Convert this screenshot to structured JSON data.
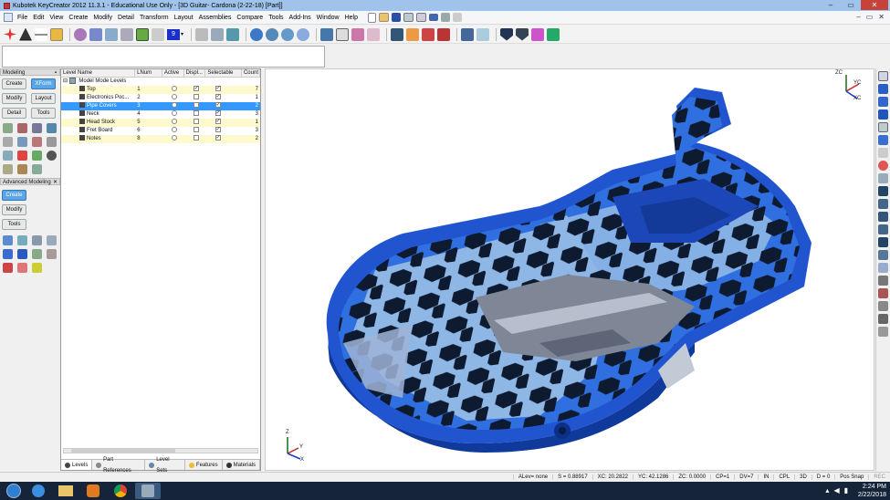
{
  "window": {
    "title": "Kubotek KeyCreator 2012 11.3.1 - Educational Use Only - [3D Guitar- Cardona (2-22-18) [Part]]",
    "controls": {
      "minimize": "–",
      "maximize": "▭",
      "close": "✕"
    }
  },
  "menu": {
    "items": [
      "File",
      "Edit",
      "View",
      "Create",
      "Modify",
      "Detail",
      "Transform",
      "Layout",
      "Assemblies",
      "Compare",
      "Tools",
      "Add-Ins",
      "Window",
      "Help"
    ],
    "right_controls": [
      "–",
      "▭",
      "✕"
    ]
  },
  "toolbar": {
    "level_value": "9",
    "icons": [
      "point-icon",
      "triangle-icon",
      "line-icon",
      "cube-icon",
      "sphere-icon",
      "shell-icon",
      "surface-icon",
      "solid-icon",
      "layers-icon",
      "color-icon",
      "grid-icon",
      "rotate-icon",
      "pan-icon",
      "zoom-icon",
      "view-icon",
      "render-icon",
      "shade-icon",
      "wireframe-icon",
      "print-icon",
      "measure-icon",
      "section-icon",
      "shield-icon",
      "snap-icon",
      "tool-icon"
    ]
  },
  "left_panel": {
    "modeling": {
      "header": "Modeling",
      "buttons": [
        "Create",
        "XForm",
        "Modify",
        "Layout",
        "Detail",
        "Tools"
      ],
      "active": "XForm"
    },
    "advanced": {
      "header": "Advanced Modeling",
      "buttons": [
        "Create",
        "Modify",
        "Tools"
      ],
      "active": "Create"
    }
  },
  "levels": {
    "columns": [
      "Level Name",
      "LNum",
      "Active",
      "Displ...",
      "Selectable",
      "Count"
    ],
    "root": "Model Mode Levels",
    "rows": [
      {
        "name": "Top",
        "lnum": "1",
        "count": "7",
        "highlight": true,
        "selected": false,
        "display": true,
        "selectable": true
      },
      {
        "name": "Electronics Poc...",
        "lnum": "2",
        "count": "1",
        "highlight": false,
        "selected": false,
        "display": false,
        "selectable": true
      },
      {
        "name": "Pipe Covers",
        "lnum": "3",
        "count": "2",
        "highlight": false,
        "selected": true,
        "display": false,
        "selectable": true
      },
      {
        "name": "Neck",
        "lnum": "4",
        "count": "3",
        "highlight": false,
        "selected": false,
        "display": false,
        "selectable": true
      },
      {
        "name": "Head Stock",
        "lnum": "5",
        "count": "1",
        "highlight": true,
        "selected": false,
        "display": false,
        "selectable": true
      },
      {
        "name": "Fret Board",
        "lnum": "6",
        "count": "3",
        "highlight": false,
        "selected": false,
        "display": false,
        "selectable": true
      },
      {
        "name": "Notes",
        "lnum": "8",
        "count": "2",
        "highlight": true,
        "selected": false,
        "display": false,
        "selectable": true
      }
    ],
    "tabs": [
      "Levels",
      "Part References",
      "Level Sets",
      "Features",
      "Materials"
    ],
    "active_tab": "Levels"
  },
  "viewport": {
    "triad_top": {
      "z": "ZC",
      "y": "YC",
      "x": "XC"
    },
    "triad_bottom": {
      "z": "Z",
      "y": "Y",
      "x": "X"
    }
  },
  "status": {
    "alev": "ALev= none",
    "s": "S = 0.88917",
    "xc": "XC: 20.2822",
    "yc": "YC: 42.1286",
    "zc": "ZC: 0.0000",
    "cp": "CP=1",
    "dv": "DV=7",
    "in": "IN",
    "cpl": "CPL",
    "mode": "3D",
    "depth": "D = 0",
    "snap": "Pos Snap",
    "rec": "REC"
  },
  "taskbar": {
    "time": "2:24 PM",
    "date": "2/22/2018",
    "apps": [
      "ie-icon",
      "explorer-icon",
      "media-icon",
      "chrome-icon",
      "keycreator-icon"
    ]
  },
  "colors": {
    "model_dark_blue": "#1f5fd6",
    "model_light_blue": "#8fb7e6",
    "model_gray": "#9fa8b8",
    "selection": "#3399ff",
    "highlight_row": "#fffacd"
  }
}
